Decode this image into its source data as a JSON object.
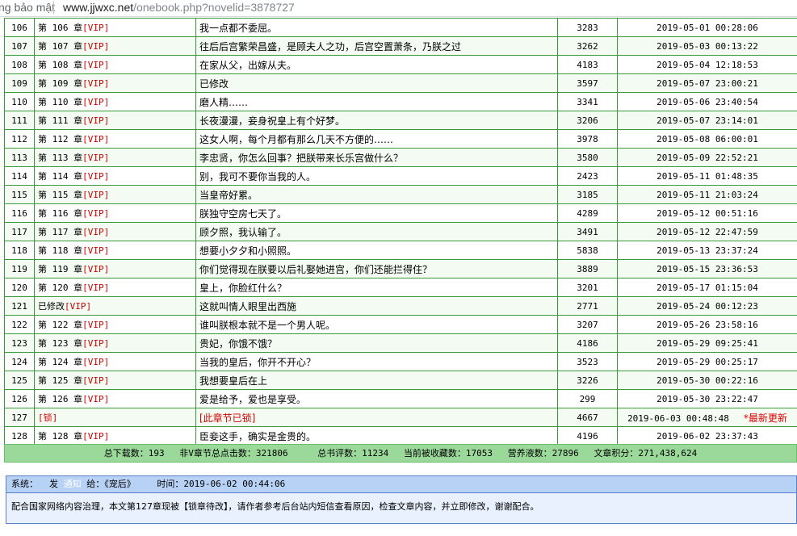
{
  "address_bar": {
    "security_label": "ng bảo mật",
    "url_host": "www.jjwxc.net",
    "url_path": "/onebook.php?novelid=3878727"
  },
  "chapters": [
    {
      "no": "106",
      "chapter": "第 106 章",
      "vip": "[VIP]",
      "title": "我一点都不委屈。",
      "words": "3283",
      "time": "2019-05-01 00:28:06"
    },
    {
      "no": "107",
      "chapter": "第 107 章",
      "vip": "[VIP]",
      "title": "往后后宫繁荣昌盛，是顾夫人之功，后宫空置萧条，乃朕之过",
      "words": "3262",
      "time": "2019-05-03 00:13:22"
    },
    {
      "no": "108",
      "chapter": "第 108 章",
      "vip": "[VIP]",
      "title": "在家从父，出嫁从夫。",
      "words": "4183",
      "time": "2019-05-04 12:18:53"
    },
    {
      "no": "109",
      "chapter": "第 109 章",
      "vip": "[VIP]",
      "title": "已修改",
      "words": "3597",
      "time": "2019-05-07 23:00:21"
    },
    {
      "no": "110",
      "chapter": "第 110 章",
      "vip": "[VIP]",
      "title": "磨人精……",
      "words": "3341",
      "time": "2019-05-06 23:40:54"
    },
    {
      "no": "111",
      "chapter": "第 111 章",
      "vip": "[VIP]",
      "title": "长夜漫漫，妾身祝皇上有个好梦。",
      "words": "3206",
      "time": "2019-05-07 23:14:01"
    },
    {
      "no": "112",
      "chapter": "第 112 章",
      "vip": "[VIP]",
      "title": "这女人啊，每个月都有那么几天不方便的……",
      "words": "3978",
      "time": "2019-05-08 06:00:01"
    },
    {
      "no": "113",
      "chapter": "第 113 章",
      "vip": "[VIP]",
      "title": "李忠贤，你怎么回事？把朕带来长乐宫做什么？",
      "words": "3580",
      "time": "2019-05-09 22:52:21"
    },
    {
      "no": "114",
      "chapter": "第 114 章",
      "vip": "[VIP]",
      "title": "别，我可不要你当我的人。",
      "words": "2423",
      "time": "2019-05-11 01:48:35"
    },
    {
      "no": "115",
      "chapter": "第 115 章",
      "vip": "[VIP]",
      "title": "当皇帝好累。",
      "words": "3185",
      "time": "2019-05-11 21:03:24"
    },
    {
      "no": "116",
      "chapter": "第 116 章",
      "vip": "[VIP]",
      "title": "朕独守空房七天了。",
      "words": "4289",
      "time": "2019-05-12 00:51:16"
    },
    {
      "no": "117",
      "chapter": "第 117 章",
      "vip": "[VIP]",
      "title": "顾夕照，我认输了。",
      "words": "3491",
      "time": "2019-05-12 22:47:59"
    },
    {
      "no": "118",
      "chapter": "第 118 章",
      "vip": "[VIP]",
      "title": "想要小夕夕和小照照。",
      "words": "5838",
      "time": "2019-05-13 23:37:24"
    },
    {
      "no": "119",
      "chapter": "第 119 章",
      "vip": "[VIP]",
      "title": "你们觉得现在朕要以后礼娶她进宫，你们还能拦得住？",
      "words": "3889",
      "time": "2019-05-15 23:36:53"
    },
    {
      "no": "120",
      "chapter": "第 120 章",
      "vip": "[VIP]",
      "title": "皇上，你脸红什么？",
      "words": "3201",
      "time": "2019-05-17 01:15:04"
    },
    {
      "no": "121",
      "chapter": "已修改",
      "vip": "[VIP]",
      "title": "这就叫情人眼里出西施",
      "words": "2771",
      "time": "2019-05-24 00:12:23"
    },
    {
      "no": "122",
      "chapter": "第 122 章",
      "vip": "[VIP]",
      "title": "谁叫朕根本就不是一个男人呢。",
      "words": "3207",
      "time": "2019-05-26 23:58:16"
    },
    {
      "no": "123",
      "chapter": "第 123 章",
      "vip": "[VIP]",
      "title": "贵妃，你饿不饿？",
      "words": "4186",
      "time": "2019-05-29 09:25:41"
    },
    {
      "no": "124",
      "chapter": "第 124 章",
      "vip": "[VIP]",
      "title": "当我的皇后，你开不开心？",
      "words": "3523",
      "time": "2019-05-29 00:25:17"
    },
    {
      "no": "125",
      "chapter": "第 125 章",
      "vip": "[VIP]",
      "title": "我想要皇后在上",
      "words": "3226",
      "time": "2019-05-30 00:22:16"
    },
    {
      "no": "126",
      "chapter": "第 126 章",
      "vip": "[VIP]",
      "title": "爱是给予，爱也是享受。",
      "words": "299",
      "time": "2019-05-30 23:22:47"
    },
    {
      "no": "127",
      "chapter": "[锁]",
      "vip": "",
      "title": "[此章节已锁]",
      "words": "4667",
      "time": "2019-06-03 00:48:48",
      "flag": "*最新更新",
      "locked": true
    },
    {
      "no": "128",
      "chapter": "第 128 章",
      "vip": "[VIP]",
      "title": "臣妾这手，确实是金贵的。",
      "words": "4196",
      "time": "2019-06-02 23:37:43"
    }
  ],
  "summary": {
    "downloads": "总下载数：193",
    "non_vip_clicks": "非V章节总点击数：321806",
    "reviews": "总书评数：11234",
    "favorites": "当前被收藏数：17053",
    "nutrients": "营养液数：27896",
    "score": "文章积分：271,438,624"
  },
  "notice": {
    "system_label": "系统：",
    "send_label": "发",
    "notify_label": "通知",
    "to_label": "给：《宠后》",
    "time_label": "时间：2019-06-02 00:44:06",
    "message": "配合国家网络内容治理，本文第127章现被【锁章待改】，请作者参考后台站内短信查看原因，检查文章内容，并立即修改，谢谢配合。"
  },
  "colors": {
    "table_border": "#3a9a3a",
    "summary_bg": "#9bd99b",
    "notice_head_bg": "#b8d2f5",
    "notice_border": "#5a7fc8",
    "vip_red": "#d00000"
  }
}
